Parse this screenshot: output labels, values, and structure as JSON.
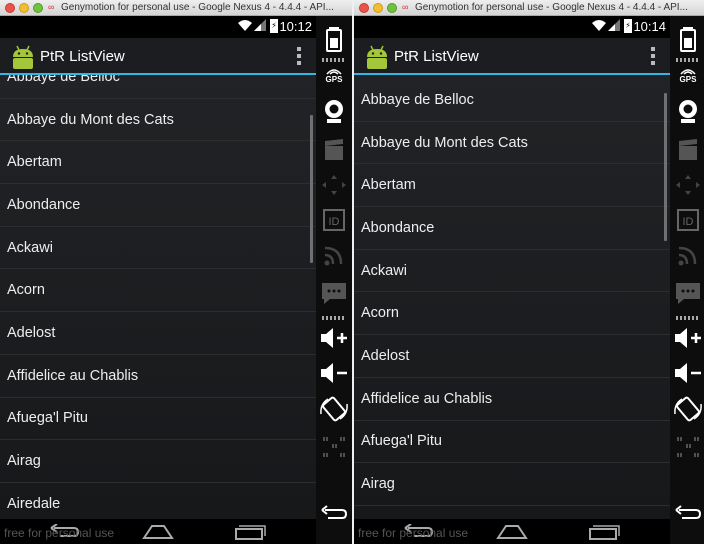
{
  "windows": [
    {
      "window_title": "Genymotion for personal use - Google Nexus 4 - 4.4.4 - API...",
      "status_time": "10:12",
      "app_title": "PtR ListView",
      "list_items": [
        "Abbaye de Belloc",
        "Abbaye du Mont des Cats",
        "Abertam",
        "Abondance",
        "Ackawi",
        "Acorn",
        "Adelost",
        "Affidelice au Chablis",
        "Afuega'l Pitu",
        "Airag",
        "Airedale"
      ],
      "watermark": "free for personal use",
      "sidebar": {
        "gps_label": "GPS",
        "id_label": "ID"
      }
    },
    {
      "window_title": "Genymotion for personal use - Google Nexus 4 - 4.4.4 - API...",
      "status_time": "10:14",
      "app_title": "PtR ListView",
      "list_items": [
        "Abbaye de Belloc",
        "Abbaye du Mont des Cats",
        "Abertam",
        "Abondance",
        "Ackawi",
        "Acorn",
        "Adelost",
        "Affidelice au Chablis",
        "Afuega'l Pitu",
        "Airag"
      ],
      "watermark": "free for personal use",
      "sidebar": {
        "gps_label": "GPS",
        "id_label": "ID"
      }
    }
  ],
  "colors": {
    "accent": "#33b5e5",
    "background": "#1b1d21"
  }
}
